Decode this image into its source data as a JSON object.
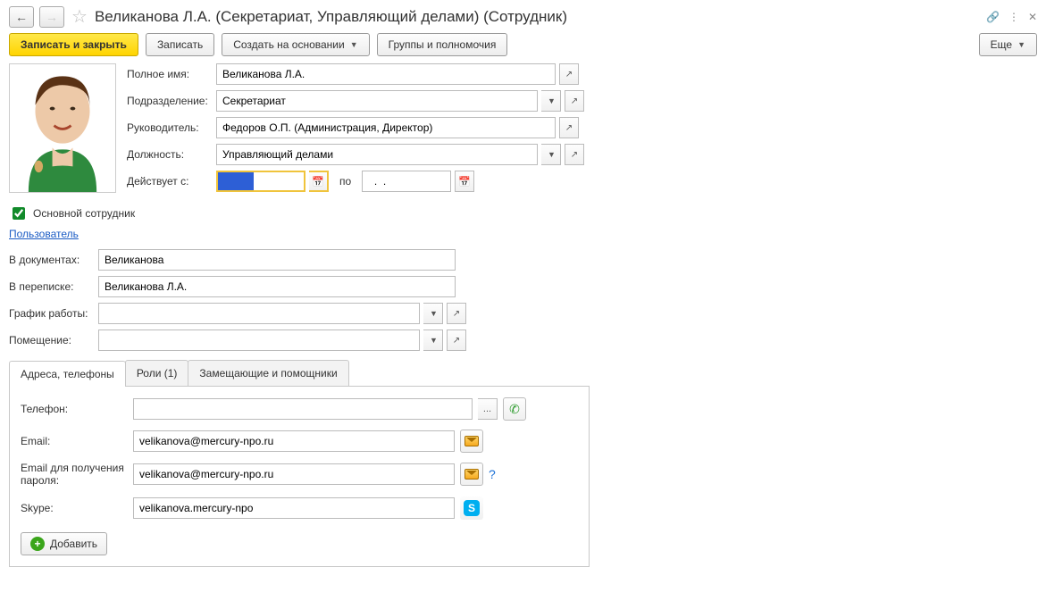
{
  "header": {
    "title": "Великанова Л.А. (Секретариат, Управляющий делами) (Сотрудник)"
  },
  "toolbar": {
    "save_close": "Записать и закрыть",
    "save": "Записать",
    "create_based": "Создать на основании",
    "groups_perm": "Группы и полномочия",
    "more": "Еще"
  },
  "form": {
    "full_name_label": "Полное имя:",
    "full_name": "Великанова Л.А.",
    "dept_label": "Подразделение:",
    "dept": "Секретариат",
    "manager_label": "Руководитель:",
    "manager": "Федоров О.П. (Администрация, Директор)",
    "position_label": "Должность:",
    "position": "Управляющий делами",
    "valid_from_label": "Действует с:",
    "valid_from": "  .  .    ",
    "valid_to_label": "по",
    "valid_to": "  .  .    "
  },
  "main_employee_label": "Основной сотрудник",
  "user_link": "Пользователь",
  "doc_label": "В документах:",
  "doc_value": "Великанова",
  "corr_label": "В переписке:",
  "corr_value": "Великанова Л.А.",
  "schedule_label": "График работы:",
  "schedule_value": "",
  "room_label": "Помещение:",
  "room_value": "",
  "tabs": {
    "addresses": "Адреса, телефоны",
    "roles": "Роли (1)",
    "subs": "Замещающие и помощники"
  },
  "contact": {
    "phone_label": "Телефон:",
    "phone": "",
    "phone_ellipsis": "...",
    "email_label": "Email:",
    "email": "velikanova@mercury-npo.ru",
    "email_pwd_label": "Email для получения пароля:",
    "email_pwd": "velikanova@mercury-npo.ru",
    "skype_label": "Skype:",
    "skype": "velikanova.mercury-npo",
    "add": "Добавить"
  }
}
